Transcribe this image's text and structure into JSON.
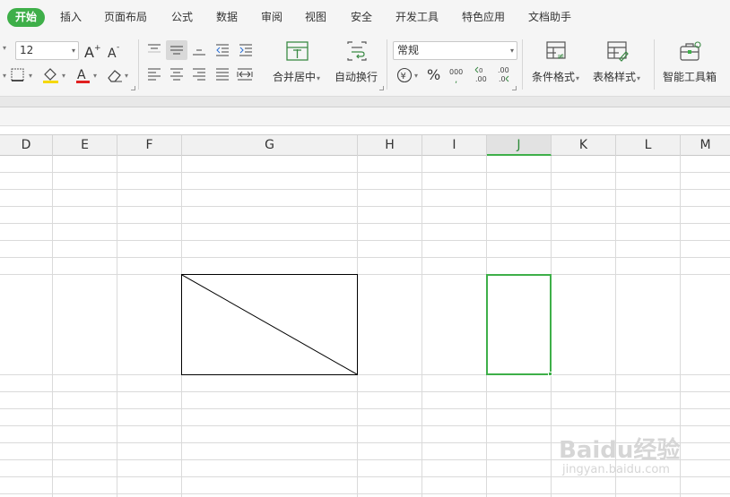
{
  "menu": {
    "tabs": [
      {
        "label": "开始",
        "active": true
      },
      {
        "label": "插入"
      },
      {
        "label": "页面布局"
      },
      {
        "label": "公式"
      },
      {
        "label": "数据"
      },
      {
        "label": "审阅"
      },
      {
        "label": "视图"
      },
      {
        "label": "安全"
      },
      {
        "label": "开发工具"
      },
      {
        "label": "特色应用"
      },
      {
        "label": "文档助手"
      }
    ]
  },
  "ribbon": {
    "font_size": "12",
    "number_format": "常规",
    "merge_center": "合并居中",
    "wrap_text": "自动换行",
    "conditional_format": "条件格式",
    "table_style": "表格样式",
    "smart_toolbox": "智能工具箱",
    "percent_symbol": "%",
    "currency_symbol": "¥",
    "thousands_symbol": "000",
    "increase_decimal": ".00",
    "decrease_decimal": ".0"
  },
  "columns": [
    {
      "label": "D"
    },
    {
      "label": "E"
    },
    {
      "label": "F"
    },
    {
      "label": "G"
    },
    {
      "label": "H"
    },
    {
      "label": "I"
    },
    {
      "label": "J",
      "selected": true
    },
    {
      "label": "K"
    },
    {
      "label": "L"
    },
    {
      "label": "M"
    }
  ],
  "watermark": {
    "line1": "Baidu经验",
    "line2": "jingyan.baidu.com"
  },
  "colors": {
    "accent": "#3eaf49",
    "border_black": "#000000",
    "font_red": "#e02020",
    "fill_yellow": "#f5d800"
  }
}
